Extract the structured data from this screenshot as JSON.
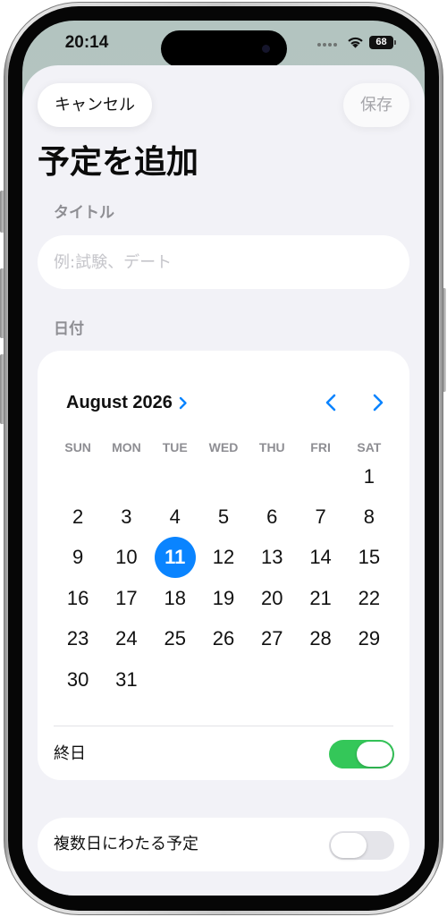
{
  "status_bar": {
    "time": "20:14",
    "battery": "68"
  },
  "nav": {
    "cancel_label": "キャンセル",
    "save_label": "保存"
  },
  "title": "予定を追加",
  "title_section": {
    "label": "タイトル",
    "placeholder": "例:試験、デート",
    "value": ""
  },
  "date_section": {
    "label": "日付"
  },
  "calendar": {
    "month_label": "August 2026",
    "weekdays": [
      "SUN",
      "MON",
      "TUE",
      "WED",
      "THU",
      "FRI",
      "SAT"
    ],
    "weeks": [
      [
        "",
        "",
        "",
        "",
        "",
        "",
        "1"
      ],
      [
        "2",
        "3",
        "4",
        "5",
        "6",
        "7",
        "8"
      ],
      [
        "9",
        "10",
        "11",
        "12",
        "13",
        "14",
        "15"
      ],
      [
        "16",
        "17",
        "18",
        "19",
        "20",
        "21",
        "22"
      ],
      [
        "23",
        "24",
        "25",
        "26",
        "27",
        "28",
        "29"
      ],
      [
        "30",
        "31",
        "",
        "",
        "",
        "",
        ""
      ]
    ],
    "selected_day": "11"
  },
  "all_day": {
    "label": "終日",
    "on": true
  },
  "multi_day": {
    "label": "複数日にわたる予定",
    "on": false
  },
  "colors": {
    "accent": "#0a84ff",
    "toggle_on": "#34c759",
    "toggle_off": "#e5e5ea",
    "sheet_background": "#f2f2f7"
  },
  "icons": {
    "signal": "signal-dots-icon",
    "wifi": "wifi-icon",
    "battery": "battery-icon",
    "month_disclosure": "chevron-right-icon",
    "previous_month": "chevron-left-icon",
    "next_month": "chevron-right-icon"
  }
}
